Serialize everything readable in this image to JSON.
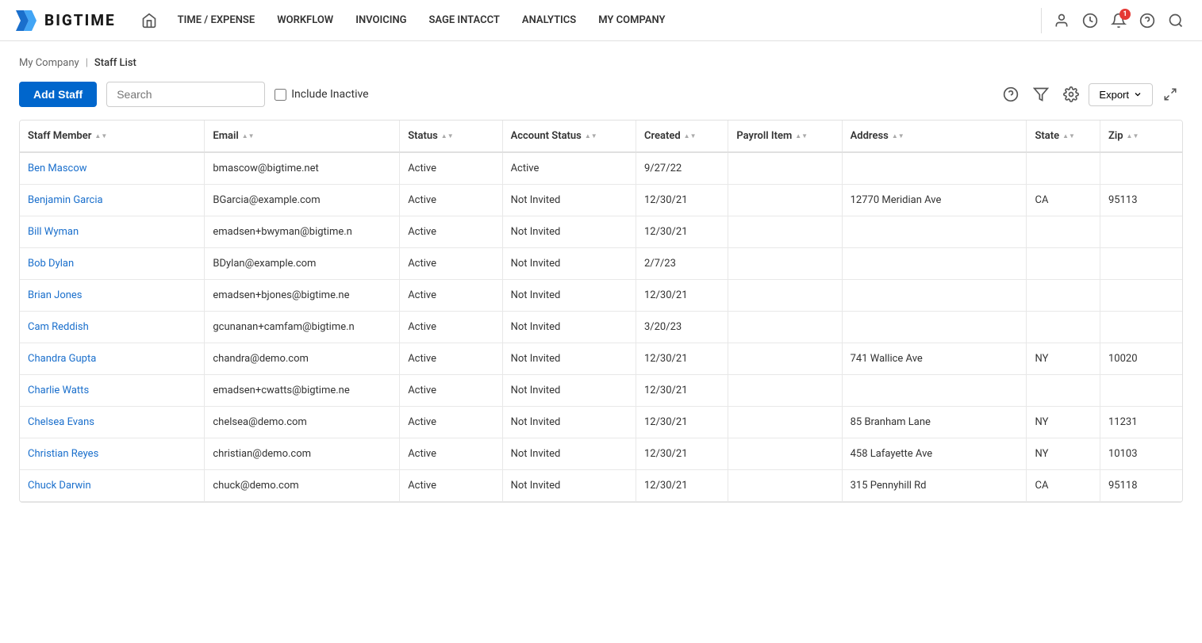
{
  "app": {
    "logo_text": "BIGTIME"
  },
  "nav": {
    "home_title": "Home",
    "items": [
      {
        "label": "TIME / EXPENSE"
      },
      {
        "label": "WORKFLOW"
      },
      {
        "label": "INVOICING"
      },
      {
        "label": "SAGE INTACCT"
      },
      {
        "label": "ANALYTICS"
      },
      {
        "label": "MY COMPANY"
      }
    ],
    "notification_count": "1"
  },
  "breadcrumb": {
    "parent": "My Company",
    "separator": "|",
    "current": "Staff List"
  },
  "toolbar": {
    "add_staff_label": "Add Staff",
    "search_placeholder": "Search",
    "include_inactive_label": "Include Inactive",
    "export_label": "Export"
  },
  "table": {
    "columns": [
      {
        "label": "Staff Member",
        "key": "staff_member"
      },
      {
        "label": "Email",
        "key": "email"
      },
      {
        "label": "Status",
        "key": "status"
      },
      {
        "label": "Account Status",
        "key": "account_status"
      },
      {
        "label": "Created",
        "key": "created"
      },
      {
        "label": "Payroll Item",
        "key": "payroll_item"
      },
      {
        "label": "Address",
        "key": "address"
      },
      {
        "label": "State",
        "key": "state"
      },
      {
        "label": "Zip",
        "key": "zip"
      }
    ],
    "rows": [
      {
        "staff_member": "Ben Mascow",
        "email": "bmascow@bigtime.net",
        "status": "Active",
        "account_status": "Active",
        "created": "9/27/22",
        "payroll_item": "",
        "address": "",
        "state": "",
        "zip": ""
      },
      {
        "staff_member": "Benjamin Garcia",
        "email": "BGarcia@example.com",
        "status": "Active",
        "account_status": "Not Invited",
        "created": "12/30/21",
        "payroll_item": "",
        "address": "12770 Meridian Ave",
        "state": "CA",
        "zip": "95113"
      },
      {
        "staff_member": "Bill Wyman",
        "email": "emadsen+bwyman@bigtime.n",
        "status": "Active",
        "account_status": "Not Invited",
        "created": "12/30/21",
        "payroll_item": "",
        "address": "",
        "state": "",
        "zip": ""
      },
      {
        "staff_member": "Bob Dylan",
        "email": "BDylan@example.com",
        "status": "Active",
        "account_status": "Not Invited",
        "created": "2/7/23",
        "payroll_item": "",
        "address": "",
        "state": "",
        "zip": ""
      },
      {
        "staff_member": "Brian Jones",
        "email": "emadsen+bjones@bigtime.ne",
        "status": "Active",
        "account_status": "Not Invited",
        "created": "12/30/21",
        "payroll_item": "",
        "address": "",
        "state": "",
        "zip": ""
      },
      {
        "staff_member": "Cam Reddish",
        "email": "gcunanan+camfam@bigtime.n",
        "status": "Active",
        "account_status": "Not Invited",
        "created": "3/20/23",
        "payroll_item": "",
        "address": "",
        "state": "",
        "zip": ""
      },
      {
        "staff_member": "Chandra Gupta",
        "email": "chandra@demo.com",
        "status": "Active",
        "account_status": "Not Invited",
        "created": "12/30/21",
        "payroll_item": "",
        "address": "741 Wallice Ave",
        "state": "NY",
        "zip": "10020"
      },
      {
        "staff_member": "Charlie Watts",
        "email": "emadsen+cwatts@bigtime.ne",
        "status": "Active",
        "account_status": "Not Invited",
        "created": "12/30/21",
        "payroll_item": "",
        "address": "",
        "state": "",
        "zip": ""
      },
      {
        "staff_member": "Chelsea Evans",
        "email": "chelsea@demo.com",
        "status": "Active",
        "account_status": "Not Invited",
        "created": "12/30/21",
        "payroll_item": "",
        "address": "85 Branham Lane",
        "state": "NY",
        "zip": "11231"
      },
      {
        "staff_member": "Christian Reyes",
        "email": "christian@demo.com",
        "status": "Active",
        "account_status": "Not Invited",
        "created": "12/30/21",
        "payroll_item": "",
        "address": "458 Lafayette Ave",
        "state": "NY",
        "zip": "10103"
      },
      {
        "staff_member": "Chuck Darwin",
        "email": "chuck@demo.com",
        "status": "Active",
        "account_status": "Not Invited",
        "created": "12/30/21",
        "payroll_item": "",
        "address": "315 Pennyhill Rd",
        "state": "CA",
        "zip": "95118"
      }
    ]
  }
}
